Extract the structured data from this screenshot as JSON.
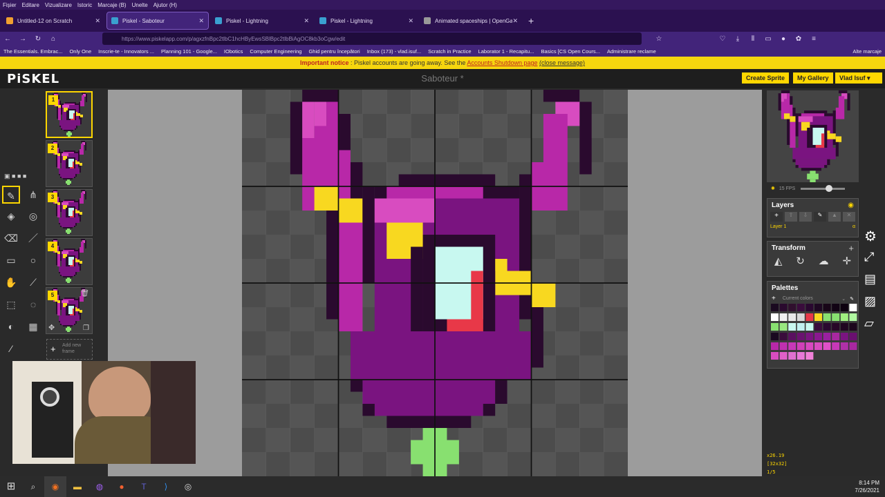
{
  "browser": {
    "menu": [
      "Fișier",
      "Editare",
      "Vizualizare",
      "Istoric",
      "Marcaje (B)",
      "Unelte",
      "Ajutor (H)"
    ],
    "tabs": [
      {
        "label": "Untitled-12 on Scratch",
        "color": "#f0a030"
      },
      {
        "label": "Piskel - Saboteur",
        "color": "#3aa0d0"
      },
      {
        "label": "Piskel - Lightning",
        "color": "#3aa0d0"
      },
      {
        "label": "Piskel - Lightning",
        "color": "#3aa0d0"
      },
      {
        "label": "Animated spaceships | OpenGa",
        "color": "#999999"
      }
    ],
    "url": "https://www.piskelapp.com/p/agxzfnBpc2tlbC1hcHByEwsSBlBpc2tlbBiAgOC8kb3oCgw/edit",
    "bookmarks": [
      "The Essentials. Embrac...",
      "Only One",
      "Inscrie-te - Innovators ...",
      "Planning 101 - Google...",
      "IObotics",
      "Computer Engineering",
      "Ghid pentru începători",
      "Inbox (173) - vlad.isuf...",
      "Scratch in Practice",
      "Laborator 1 - Recapitu...",
      "Basics [CS Open Cours...",
      "Administrare reclame",
      "Alte marcaje"
    ]
  },
  "notice": {
    "bold": "Important notice",
    "text": " : Piskel accounts are going away. See the ",
    "link": "Accounts Shutdown page",
    "close": "(close message)"
  },
  "app": {
    "logo": "PiSKEL",
    "title": "Saboteur *",
    "create": "Create Sprite",
    "gallery": "My Gallery",
    "user": "Vlad Isuf"
  },
  "frames": [
    "1",
    "2",
    "3",
    "4",
    "5"
  ],
  "add_frame": "Add new frame",
  "fps": "15 FPS",
  "layers": {
    "title": "Layers",
    "item": "Layer 1",
    "alpha": "α"
  },
  "transform": {
    "title": "Transform"
  },
  "palettes": {
    "title": "Palettes",
    "current": "Current colors"
  },
  "status": {
    "coords": "x26.19",
    "size": "[32x32]",
    "frame": "1/5"
  },
  "clock": {
    "time": "8:14 PM",
    "date": "7/26/2021"
  },
  "colors": {
    "accent": "#ffd700",
    "dark": "#2a0a2e",
    "purple": "#7a1480",
    "magenta": "#b828a8",
    "pink": "#d84cc0",
    "yellow": "#f8d820",
    "red": "#e83848",
    "cyan": "#c8f8f0",
    "green": "#88e070"
  }
}
